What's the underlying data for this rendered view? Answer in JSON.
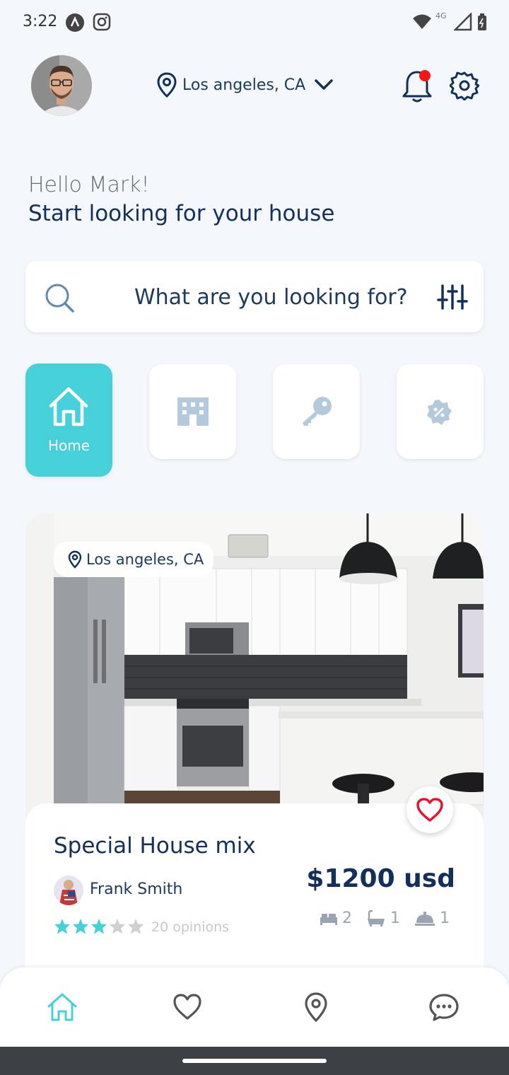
{
  "status_bar": {
    "time": "3:22",
    "network": "4G"
  },
  "header": {
    "location": "Los angeles, CA"
  },
  "greeting": {
    "hello": "Hello Mark!",
    "subtitle": "Start looking for your house"
  },
  "search": {
    "placeholder": "What are you looking for?"
  },
  "categories": [
    {
      "label": "Home",
      "icon": "house-icon",
      "active": true
    },
    {
      "label": "",
      "icon": "building-icon",
      "active": false
    },
    {
      "label": "",
      "icon": "key-icon",
      "active": false
    },
    {
      "label": "",
      "icon": "discount-badge-icon",
      "active": false
    }
  ],
  "property": {
    "location": "Los angeles, CA",
    "title": "Special House mix",
    "agent": "Frank Smith",
    "rating": 3,
    "rating_max": 5,
    "opinions": "20 opinions",
    "price": "$1200 usd",
    "beds": "2",
    "baths": "1",
    "services": "1"
  },
  "colors": {
    "accent": "#45d0da",
    "text_dark": "#12305a",
    "notification": "#ff1212"
  }
}
